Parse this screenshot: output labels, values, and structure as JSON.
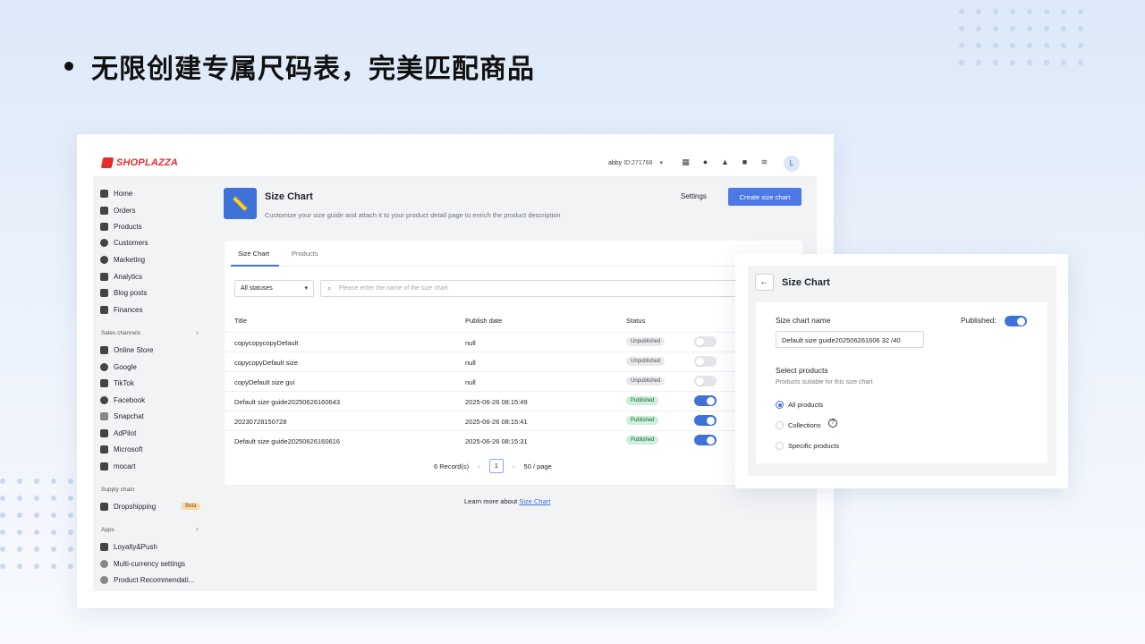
{
  "headline": "无限创建专属尺码表，完美匹配商品",
  "brand": {
    "name": "SHOPLAZZA",
    "color": "#e62c2c"
  },
  "account": {
    "name": "abby",
    "id": "ID:271768"
  },
  "top_icons": [
    "store-icon",
    "help-icon",
    "bell-icon",
    "chat-icon",
    "wifi-icon"
  ],
  "avatar_letter": "L",
  "accent": "#3f72d8",
  "sidebar": {
    "main": [
      {
        "label": "Home",
        "icon": "home-icon"
      },
      {
        "label": "Orders",
        "icon": "orders-icon"
      },
      {
        "label": "Products",
        "icon": "tag-icon"
      },
      {
        "label": "Customers",
        "icon": "person-icon"
      },
      {
        "label": "Marketing",
        "icon": "target-icon"
      },
      {
        "label": "Analytics",
        "icon": "bar-chart-icon"
      },
      {
        "label": "Blog posts",
        "icon": "pencil-icon"
      },
      {
        "label": "Finances",
        "icon": "wallet-icon"
      }
    ],
    "sales_title": "Sales channels",
    "sales": [
      {
        "label": "Online Store",
        "icon": "store-icon"
      },
      {
        "label": "Google",
        "icon": "google-icon"
      },
      {
        "label": "TikTok",
        "icon": "tiktok-icon"
      },
      {
        "label": "Facebook",
        "icon": "facebook-icon"
      },
      {
        "label": "Snapchat",
        "icon": "snapchat-icon"
      },
      {
        "label": "AdPilot",
        "icon": "adpilot-icon"
      },
      {
        "label": "Microsoft",
        "icon": "microsoft-icon"
      },
      {
        "label": "mocart",
        "icon": "mocart-icon"
      }
    ],
    "supply_title": "Supply chain",
    "dropshipping": "Dropshipping",
    "beta": "Beta",
    "apps_title": "Apps",
    "apps": [
      {
        "label": "Loyalty&Push",
        "icon": "loyalty-icon"
      },
      {
        "label": "Multi-currency settings",
        "icon": "currency-icon"
      },
      {
        "label": "Product Recommendati...",
        "icon": "recommend-icon"
      }
    ]
  },
  "page": {
    "title": "Size Chart",
    "description": "Customize your size guide and attach it to your product detail page to enrich the product description",
    "settings": "Settings",
    "create": "Create size chart"
  },
  "tabs": [
    "Size Chart",
    "Products"
  ],
  "filter": {
    "status": "All statuses",
    "search_placeholder": "Please enter the name of the size chart"
  },
  "table": {
    "headers": [
      "Title",
      "Publish date",
      "Status"
    ],
    "rows": [
      {
        "title": "copycopycopyDefault",
        "date": "null",
        "status": "Unpublished",
        "on": false
      },
      {
        "title": "copycopyDefault size",
        "date": "null",
        "status": "Unpublished",
        "on": false
      },
      {
        "title": "copyDefault size gui",
        "date": "null",
        "status": "Unpublished",
        "on": false
      },
      {
        "title": "Default size guide20250626160643",
        "date": "2025-06-26 08:15:49",
        "status": "Published",
        "on": true
      },
      {
        "title": "20230728150728",
        "date": "2025-06-26 08:15:41",
        "status": "Published",
        "on": true
      },
      {
        "title": "Default size guide20250626160616",
        "date": "2025-06-26 08:15:31",
        "status": "Published",
        "on": true
      }
    ]
  },
  "pager": {
    "records": "6 Record(s)",
    "page": "1",
    "per_page": "50 / page"
  },
  "learn": {
    "prefix": "Learn more about",
    "link": "Size Chart"
  },
  "panel": {
    "title": "Size Chart",
    "name_label": "Size chart name",
    "published_label": "Published:",
    "name_value": "Default size guide202506261606 32 /40",
    "select_label": "Select products",
    "select_sub": "Products suitable for this size chart",
    "options": [
      "All products",
      "Collections",
      "Specific products"
    ],
    "selected": "All products"
  }
}
